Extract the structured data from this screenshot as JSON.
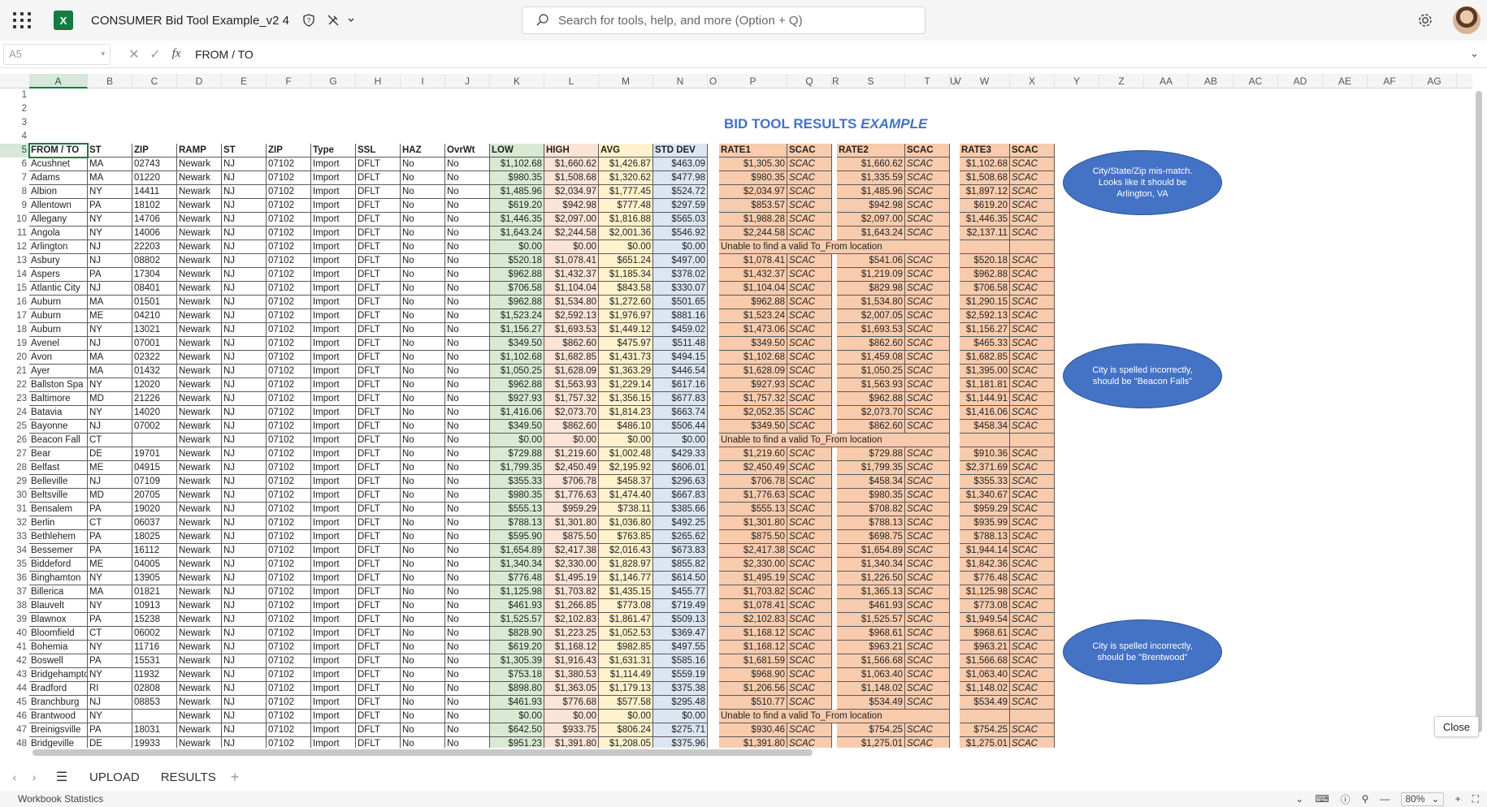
{
  "app": {
    "title": "CONSUMER Bid Tool Example_v2 4"
  },
  "search": {
    "placeholder": "Search for tools, help, and more (Option + Q)"
  },
  "formula_bar": {
    "name_box": "A5",
    "value": "FROM / TO"
  },
  "columns": [
    "A",
    "B",
    "C",
    "D",
    "E",
    "F",
    "G",
    "H",
    "I",
    "J",
    "K",
    "L",
    "M",
    "N",
    "O",
    "P",
    "Q",
    "R",
    "S",
    "T",
    "U",
    "V",
    "W",
    "X",
    "Y",
    "Z",
    "AA",
    "AB",
    "AC",
    "AD",
    "AE",
    "AF",
    "AG"
  ],
  "sheet_title": {
    "main": "BID TOOL RESULTS ",
    "emph": "EXAMPLE"
  },
  "headers": {
    "left": [
      "FROM / TO",
      "ST",
      "ZIP",
      "RAMP",
      "ST",
      "ZIP",
      "Type",
      "SSL",
      "HAZ",
      "OvrWt",
      "LOW",
      "HIGH",
      "AVG",
      "STD DEV"
    ],
    "rate1": [
      "RATE1",
      "SCAC"
    ],
    "rate2": [
      "RATE2",
      "SCAC"
    ],
    "rate3": [
      "RATE3",
      "SCAC"
    ]
  },
  "rows": [
    [
      "Acushnet",
      "MA",
      "02743",
      "Newark",
      "NJ",
      "07102",
      "Import",
      "DFLT",
      "No",
      "No",
      "$1,102.68",
      "$1,660.62",
      "$1,426.87",
      "$463.09",
      "$1,305.30",
      "SCAC",
      "$1,660.62",
      "SCAC",
      "$1,102.68",
      "SCAC"
    ],
    [
      "Adams",
      "MA",
      "01220",
      "Newark",
      "NJ",
      "07102",
      "Import",
      "DFLT",
      "No",
      "No",
      "$980.35",
      "$1,508.68",
      "$1,320.62",
      "$477.98",
      "$980.35",
      "SCAC",
      "$1,335.59",
      "SCAC",
      "$1,508.68",
      "SCAC"
    ],
    [
      "Albion",
      "NY",
      "14411",
      "Newark",
      "NJ",
      "07102",
      "Import",
      "DFLT",
      "No",
      "No",
      "$1,485.96",
      "$2,034.97",
      "$1,777.45",
      "$524.72",
      "$2,034.97",
      "SCAC",
      "$1,485.96",
      "SCAC",
      "$1,897.12",
      "SCAC"
    ],
    [
      "Allentown",
      "PA",
      "18102",
      "Newark",
      "NJ",
      "07102",
      "Import",
      "DFLT",
      "No",
      "No",
      "$619.20",
      "$942.98",
      "$777.48",
      "$297.59",
      "$853.57",
      "SCAC",
      "$942.98",
      "SCAC",
      "$619.20",
      "SCAC"
    ],
    [
      "Allegany",
      "NY",
      "14706",
      "Newark",
      "NJ",
      "07102",
      "Import",
      "DFLT",
      "No",
      "No",
      "$1,446.35",
      "$2,097.00",
      "$1,816.88",
      "$565.03",
      "$1,988.28",
      "SCAC",
      "$2,097.00",
      "SCAC",
      "$1,446.35",
      "SCAC"
    ],
    [
      "Angola",
      "NY",
      "14006",
      "Newark",
      "NJ",
      "07102",
      "Import",
      "DFLT",
      "No",
      "No",
      "$1,643.24",
      "$2,244.58",
      "$2,001.36",
      "$546.92",
      "$2,244.58",
      "SCAC",
      "$1,643.24",
      "SCAC",
      "$2,137.11",
      "SCAC"
    ],
    [
      "Arlington",
      "NJ",
      "22203",
      "Newark",
      "NJ",
      "07102",
      "Import",
      "DFLT",
      "No",
      "No",
      "$0.00",
      "$0.00",
      "$0.00",
      "$0.00",
      "Unable to find a valid To_From location",
      "",
      "",
      "",
      "",
      ""
    ],
    [
      "Asbury",
      "NJ",
      "08802",
      "Newark",
      "NJ",
      "07102",
      "Import",
      "DFLT",
      "No",
      "No",
      "$520.18",
      "$1,078.41",
      "$651.24",
      "$497.00",
      "$1,078.41",
      "SCAC",
      "$541.06",
      "SCAC",
      "$520.18",
      "SCAC"
    ],
    [
      "Aspers",
      "PA",
      "17304",
      "Newark",
      "NJ",
      "07102",
      "Import",
      "DFLT",
      "No",
      "No",
      "$962.88",
      "$1,432.37",
      "$1,185.34",
      "$378.02",
      "$1,432.37",
      "SCAC",
      "$1,219.09",
      "SCAC",
      "$962.88",
      "SCAC"
    ],
    [
      "Atlantic City",
      "NJ",
      "08401",
      "Newark",
      "NJ",
      "07102",
      "Import",
      "DFLT",
      "No",
      "No",
      "$706.58",
      "$1,104.04",
      "$843.58",
      "$330.07",
      "$1,104.04",
      "SCAC",
      "$829.98",
      "SCAC",
      "$706.58",
      "SCAC"
    ],
    [
      "Auburn",
      "MA",
      "01501",
      "Newark",
      "NJ",
      "07102",
      "Import",
      "DFLT",
      "No",
      "No",
      "$962.88",
      "$1,534.80",
      "$1,272.60",
      "$501.65",
      "$962.88",
      "SCAC",
      "$1,534.80",
      "SCAC",
      "$1,290.15",
      "SCAC"
    ],
    [
      "Auburn",
      "ME",
      "04210",
      "Newark",
      "NJ",
      "07102",
      "Import",
      "DFLT",
      "No",
      "No",
      "$1,523.24",
      "$2,592.13",
      "$1,976.97",
      "$881.16",
      "$1,523.24",
      "SCAC",
      "$2,007.05",
      "SCAC",
      "$2,592.13",
      "SCAC"
    ],
    [
      "Auburn",
      "NY",
      "13021",
      "Newark",
      "NJ",
      "07102",
      "Import",
      "DFLT",
      "No",
      "No",
      "$1,156.27",
      "$1,693.53",
      "$1,449.12",
      "$459.02",
      "$1,473.06",
      "SCAC",
      "$1,693.53",
      "SCAC",
      "$1,156.27",
      "SCAC"
    ],
    [
      "Avenel",
      "NJ",
      "07001",
      "Newark",
      "NJ",
      "07102",
      "Import",
      "DFLT",
      "No",
      "No",
      "$349.50",
      "$862.60",
      "$475.97",
      "$511.48",
      "$349.50",
      "SCAC",
      "$862.60",
      "SCAC",
      "$465.33",
      "SCAC"
    ],
    [
      "Avon",
      "MA",
      "02322",
      "Newark",
      "NJ",
      "07102",
      "Import",
      "DFLT",
      "No",
      "No",
      "$1,102.68",
      "$1,682.85",
      "$1,431.73",
      "$494.15",
      "$1,102.68",
      "SCAC",
      "$1,459.08",
      "SCAC",
      "$1,682.85",
      "SCAC"
    ],
    [
      "Ayer",
      "MA",
      "01432",
      "Newark",
      "NJ",
      "07102",
      "Import",
      "DFLT",
      "No",
      "No",
      "$1,050.25",
      "$1,628.09",
      "$1,363.29",
      "$446.54",
      "$1,628.09",
      "SCAC",
      "$1,050.25",
      "SCAC",
      "$1,395.00",
      "SCAC"
    ],
    [
      "Ballston Spa",
      "NY",
      "12020",
      "Newark",
      "NJ",
      "07102",
      "Import",
      "DFLT",
      "No",
      "No",
      "$962.88",
      "$1,563.93",
      "$1,229.14",
      "$617.16",
      "$927.93",
      "SCAC",
      "$1,563.93",
      "SCAC",
      "$1,181.81",
      "SCAC"
    ],
    [
      "Baltimore",
      "MD",
      "21226",
      "Newark",
      "NJ",
      "07102",
      "Import",
      "DFLT",
      "No",
      "No",
      "$927.93",
      "$1,757.32",
      "$1,356.15",
      "$677.83",
      "$1,757.32",
      "SCAC",
      "$962.88",
      "SCAC",
      "$1,144.91",
      "SCAC"
    ],
    [
      "Batavia",
      "NY",
      "14020",
      "Newark",
      "NJ",
      "07102",
      "Import",
      "DFLT",
      "No",
      "No",
      "$1,416.06",
      "$2,073.70",
      "$1,814.23",
      "$663.74",
      "$2,052.35",
      "SCAC",
      "$2,073.70",
      "SCAC",
      "$1,416.06",
      "SCAC"
    ],
    [
      "Bayonne",
      "NJ",
      "07002",
      "Newark",
      "NJ",
      "07102",
      "Import",
      "DFLT",
      "No",
      "No",
      "$349.50",
      "$862.60",
      "$486.10",
      "$506.44",
      "$349.50",
      "SCAC",
      "$862.60",
      "SCAC",
      "$458.34",
      "SCAC"
    ],
    [
      "Beacon Fall",
      "CT",
      "",
      "Newark",
      "NJ",
      "07102",
      "Import",
      "DFLT",
      "No",
      "No",
      "$0.00",
      "$0.00",
      "$0.00",
      "$0.00",
      "Unable to find a valid To_From location",
      "",
      "",
      "",
      "",
      ""
    ],
    [
      "Bear",
      "DE",
      "19701",
      "Newark",
      "NJ",
      "07102",
      "Import",
      "DFLT",
      "No",
      "No",
      "$729.88",
      "$1,219.60",
      "$1,002.48",
      "$429.33",
      "$1,219.60",
      "SCAC",
      "$729.88",
      "SCAC",
      "$910.36",
      "SCAC"
    ],
    [
      "Belfast",
      "ME",
      "04915",
      "Newark",
      "NJ",
      "07102",
      "Import",
      "DFLT",
      "No",
      "No",
      "$1,799.35",
      "$2,450.49",
      "$2,195.92",
      "$606.01",
      "$2,450.49",
      "SCAC",
      "$1,799.35",
      "SCAC",
      "$2,371.69",
      "SCAC"
    ],
    [
      "Belleville",
      "NJ",
      "07109",
      "Newark",
      "NJ",
      "07102",
      "Import",
      "DFLT",
      "No",
      "No",
      "$355.33",
      "$706.78",
      "$458.37",
      "$296.63",
      "$706.78",
      "SCAC",
      "$458.34",
      "SCAC",
      "$355.33",
      "SCAC"
    ],
    [
      "Beltsville",
      "MD",
      "20705",
      "Newark",
      "NJ",
      "07102",
      "Import",
      "DFLT",
      "No",
      "No",
      "$980.35",
      "$1,776.63",
      "$1,474.40",
      "$667.83",
      "$1,776.63",
      "SCAC",
      "$980.35",
      "SCAC",
      "$1,340.67",
      "SCAC"
    ],
    [
      "Bensalem",
      "PA",
      "19020",
      "Newark",
      "NJ",
      "07102",
      "Import",
      "DFLT",
      "No",
      "No",
      "$555.13",
      "$959.29",
      "$738.11",
      "$385.66",
      "$555.13",
      "SCAC",
      "$708.82",
      "SCAC",
      "$959.29",
      "SCAC"
    ],
    [
      "Berlin",
      "CT",
      "06037",
      "Newark",
      "NJ",
      "07102",
      "Import",
      "DFLT",
      "No",
      "No",
      "$788.13",
      "$1,301.80",
      "$1,036.80",
      "$492.25",
      "$1,301.80",
      "SCAC",
      "$788.13",
      "SCAC",
      "$935.99",
      "SCAC"
    ],
    [
      "Bethlehem",
      "PA",
      "18025",
      "Newark",
      "NJ",
      "07102",
      "Import",
      "DFLT",
      "No",
      "No",
      "$595.90",
      "$875.50",
      "$763.85",
      "$265.62",
      "$875.50",
      "SCAC",
      "$698.75",
      "SCAC",
      "$788.13",
      "SCAC"
    ],
    [
      "Bessemer",
      "PA",
      "16112",
      "Newark",
      "NJ",
      "07102",
      "Import",
      "DFLT",
      "No",
      "No",
      "$1,654.89",
      "$2,417.38",
      "$2,016.43",
      "$673.83",
      "$2,417.38",
      "SCAC",
      "$1,654.89",
      "SCAC",
      "$1,944.14",
      "SCAC"
    ],
    [
      "Biddeford",
      "ME",
      "04005",
      "Newark",
      "NJ",
      "07102",
      "Import",
      "DFLT",
      "No",
      "No",
      "$1,340.34",
      "$2,330.00",
      "$1,828.97",
      "$855.82",
      "$2,330.00",
      "SCAC",
      "$1,340.34",
      "SCAC",
      "$1,842.36",
      "SCAC"
    ],
    [
      "Binghamton",
      "NY",
      "13905",
      "Newark",
      "NJ",
      "07102",
      "Import",
      "DFLT",
      "No",
      "No",
      "$776.48",
      "$1,495.19",
      "$1,146.77",
      "$614.50",
      "$1,495.19",
      "SCAC",
      "$1,226.50",
      "SCAC",
      "$776.48",
      "SCAC"
    ],
    [
      "Billerica",
      "MA",
      "01821",
      "Newark",
      "NJ",
      "07102",
      "Import",
      "DFLT",
      "No",
      "No",
      "$1,125.98",
      "$1,703.82",
      "$1,435.15",
      "$455.77",
      "$1,703.82",
      "SCAC",
      "$1,365.13",
      "SCAC",
      "$1,125.98",
      "SCAC"
    ],
    [
      "Blauvelt",
      "NY",
      "10913",
      "Newark",
      "NJ",
      "07102",
      "Import",
      "DFLT",
      "No",
      "No",
      "$461.93",
      "$1,266.85",
      "$773.08",
      "$719.49",
      "$1,078.41",
      "SCAC",
      "$461.93",
      "SCAC",
      "$773.08",
      "SCAC"
    ],
    [
      "Blawnox",
      "PA",
      "15238",
      "Newark",
      "NJ",
      "07102",
      "Import",
      "DFLT",
      "No",
      "No",
      "$1,525.57",
      "$2,102.83",
      "$1,861.47",
      "$509.13",
      "$2,102.83",
      "SCAC",
      "$1,525.57",
      "SCAC",
      "$1,949.54",
      "SCAC"
    ],
    [
      "Bloomfield",
      "CT",
      "06002",
      "Newark",
      "NJ",
      "07102",
      "Import",
      "DFLT",
      "No",
      "No",
      "$828.90",
      "$1,223.25",
      "$1,052.53",
      "$369.47",
      "$1,168.12",
      "SCAC",
      "$968.61",
      "SCAC",
      "$968.61",
      "SCAC"
    ],
    [
      "Bohemia",
      "NY",
      "11716",
      "Newark",
      "NJ",
      "07102",
      "Import",
      "DFLT",
      "No",
      "No",
      "$619.20",
      "$1,168.12",
      "$982.85",
      "$497.55",
      "$1,168.12",
      "SCAC",
      "$963.21",
      "SCAC",
      "$963.21",
      "SCAC"
    ],
    [
      "Boswell",
      "PA",
      "15531",
      "Newark",
      "NJ",
      "07102",
      "Import",
      "DFLT",
      "No",
      "No",
      "$1,305.39",
      "$1,916.43",
      "$1,631.31",
      "$585.16",
      "$1,681.59",
      "SCAC",
      "$1,566.68",
      "SCAC",
      "$1,566.68",
      "SCAC"
    ],
    [
      "Bridgehampton",
      "NY",
      "11932",
      "Newark",
      "NJ",
      "07102",
      "Import",
      "DFLT",
      "No",
      "No",
      "$753.18",
      "$1,380.53",
      "$1,114.49",
      "$559.19",
      "$968.90",
      "SCAC",
      "$1,063.40",
      "SCAC",
      "$1,063.40",
      "SCAC"
    ],
    [
      "Bradford",
      "RI",
      "02808",
      "Newark",
      "NJ",
      "07102",
      "Import",
      "DFLT",
      "No",
      "No",
      "$898.80",
      "$1,363.05",
      "$1,179.13",
      "$375.38",
      "$1,206.56",
      "SCAC",
      "$1,148.02",
      "SCAC",
      "$1,148.02",
      "SCAC"
    ],
    [
      "Branchburg",
      "NJ",
      "08853",
      "Newark",
      "NJ",
      "07102",
      "Import",
      "DFLT",
      "No",
      "No",
      "$461.93",
      "$776.68",
      "$577.58",
      "$295.48",
      "$510.77",
      "SCAC",
      "$534.49",
      "SCAC",
      "$534.49",
      "SCAC"
    ],
    [
      "Brantwood",
      "NY",
      "",
      "Newark",
      "NJ",
      "07102",
      "Import",
      "DFLT",
      "No",
      "No",
      "$0.00",
      "$0.00",
      "$0.00",
      "$0.00",
      "Unable to find a valid To_From location",
      "",
      "",
      "",
      "",
      ""
    ],
    [
      "Breinigsville",
      "PA",
      "18031",
      "Newark",
      "NJ",
      "07102",
      "Import",
      "DFLT",
      "No",
      "No",
      "$642.50",
      "$933.75",
      "$806.24",
      "$275.71",
      "$930.46",
      "SCAC",
      "$754.25",
      "SCAC",
      "$754.25",
      "SCAC"
    ],
    [
      "Bridgeville",
      "DE",
      "19933",
      "Newark",
      "NJ",
      "07102",
      "Import",
      "DFLT",
      "No",
      "No",
      "$951.23",
      "$1,391.80",
      "$1,208.05",
      "$375.96",
      "$1,391.80",
      "SCAC",
      "$1,275.01",
      "SCAC",
      "$1,275.01",
      "SCAC"
    ]
  ],
  "callouts": [
    {
      "text": "City/State/Zip mis-match. Looks like it should be Arlington, VA"
    },
    {
      "text": "City is spelled incorrectly, should be \"Beacon Falls\""
    },
    {
      "text": "City is spelled incorrectly, should be \"Brentwood\""
    }
  ],
  "close_label": "Close",
  "sheets": [
    {
      "label": "UPLOAD"
    },
    {
      "label": "RESULTS"
    }
  ],
  "status": {
    "workbook_stats": "Workbook Statistics",
    "zoom": "80%"
  },
  "colors": {
    "accent": "#107c41",
    "title_blue": "#4472c4",
    "low": "#d9ead3",
    "high": "#fbe3d6",
    "avg": "#fff2cc",
    "std": "#dce6f2",
    "rate": "#f8cbad"
  }
}
